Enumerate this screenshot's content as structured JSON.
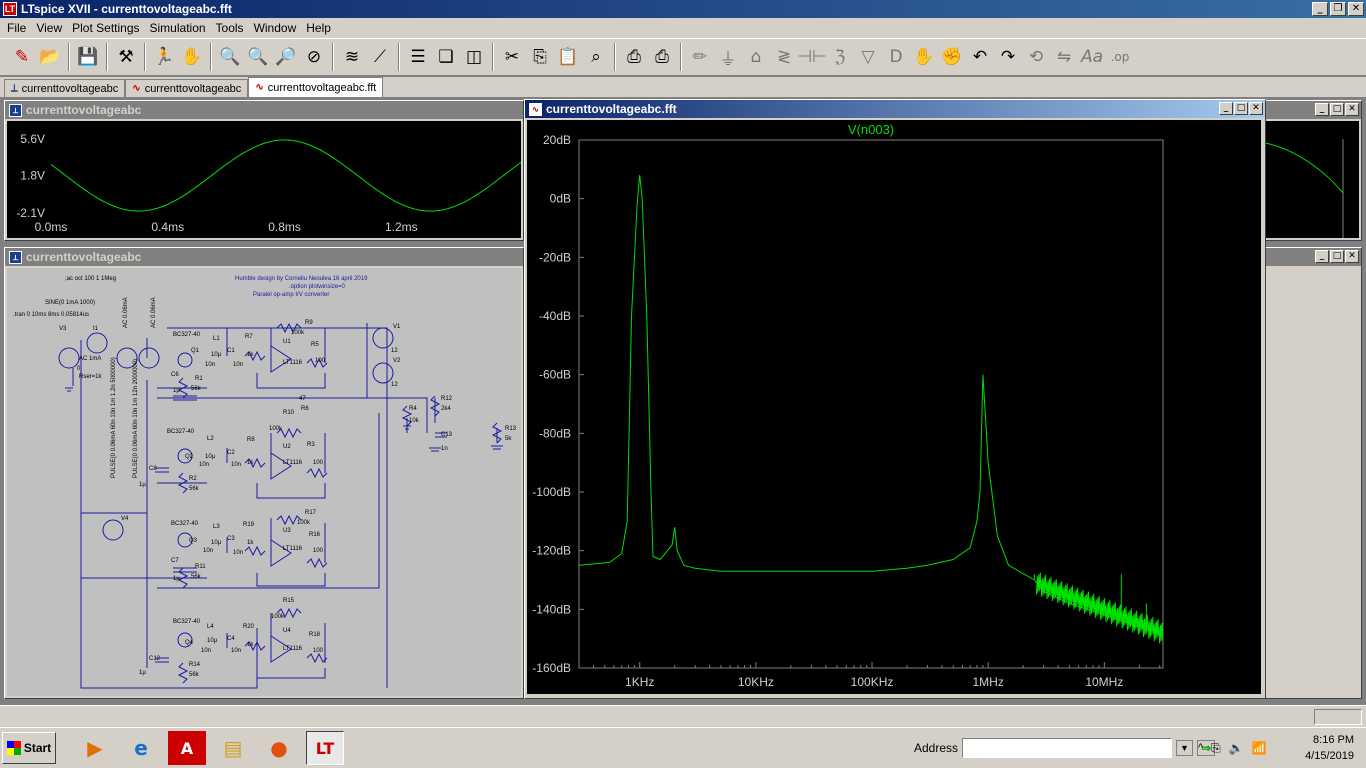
{
  "window": {
    "title": "LTspice XVII - currenttovoltageabc.fft",
    "app_icon": "LT"
  },
  "menu": [
    "File",
    "View",
    "Plot Settings",
    "Simulation",
    "Tools",
    "Window",
    "Help"
  ],
  "toolbar_icons": [
    "new-schematic-icon",
    "open-icon",
    "save-icon",
    "control-panel-icon",
    "run-icon",
    "halt-icon",
    "zoom-in-icon",
    "zoom-out-icon",
    "zoom-fit-icon",
    "zoom-cancel-icon",
    "autorange-icon",
    "pick-visible-traces-icon",
    "tile-horizontal-icon",
    "cascade-icon",
    "tile-vertical-icon",
    "cut-icon",
    "copy-icon",
    "paste-icon",
    "find-icon",
    "print-icon",
    "print-setup-icon",
    "draw-wire-icon",
    "ground-icon",
    "label-net-icon",
    "resistor-icon",
    "capacitor-icon",
    "inductor-icon",
    "diode-icon",
    "component-icon",
    "move-icon",
    "drag-icon",
    "undo-icon",
    "redo-icon",
    "rotate-icon",
    "mirror-icon",
    "text-icon",
    "spice-directive-icon"
  ],
  "tabs": [
    {
      "label": "currenttovoltageabc",
      "icon": "schematic-icon",
      "active": false
    },
    {
      "label": "currenttovoltageabc",
      "icon": "waveform-icon",
      "active": false
    },
    {
      "label": "currenttovoltageabc.fft",
      "icon": "waveform-icon",
      "active": true
    }
  ],
  "windows": {
    "time_plot": {
      "title": "currenttovoltageabc"
    },
    "schematic": {
      "title": "currenttovoltageabc"
    },
    "fft_plot": {
      "title": "currenttovoltageabc.fft"
    }
  },
  "time_chart": {
    "type": "line",
    "title": "",
    "y_ticks": [
      "5.6V",
      "1.8V",
      "-2.1V"
    ],
    "y_tick_values": [
      5.6,
      1.8,
      -2.1
    ],
    "x_ticks": [
      "0.0ms",
      "0.4ms",
      "0.8ms",
      "1.2ms"
    ],
    "x_tick_values": [
      0.0,
      0.4,
      0.8,
      1.2
    ],
    "xlim": [
      0.0,
      1.61
    ],
    "ylim": [
      -2.1,
      5.6
    ],
    "series": [
      {
        "x": [
          0.0,
          0.1,
          0.25,
          0.5,
          0.75,
          1.0,
          1.25,
          1.5
        ],
        "y": [
          1.8,
          0.6,
          -1.9,
          1.8,
          5.5,
          1.8,
          -1.9,
          1.8
        ]
      }
    ],
    "color": "#00e000"
  },
  "fft_chart": {
    "type": "line",
    "trace_label": "V(n003)",
    "x_scale": "log",
    "y_ticks": [
      "20dB",
      "0dB",
      "-20dB",
      "-40dB",
      "-60dB",
      "-80dB",
      "-100dB",
      "-120dB",
      "-140dB",
      "-160dB"
    ],
    "y_tick_values": [
      20,
      0,
      -20,
      -40,
      -60,
      -80,
      -100,
      -120,
      -140,
      -160
    ],
    "x_ticks": [
      "1KHz",
      "10KHz",
      "100KHz",
      "1MHz",
      "10MHz"
    ],
    "x_tick_values": [
      1000,
      10000,
      100000,
      1000000,
      10000000
    ],
    "xlim": [
      300,
      32000000
    ],
    "ylim": [
      -160,
      20
    ],
    "series": [
      {
        "x": [
          300,
          550,
          700,
          780,
          850,
          950,
          1000,
          1050,
          1150,
          1250,
          1300,
          1500,
          1900,
          2000,
          2100,
          2400,
          3000,
          5000,
          20000,
          100000,
          200000,
          300000,
          500000,
          700000,
          800000,
          850000,
          900000,
          1000000,
          1200000,
          1500000,
          2500000,
          3000000,
          5000000,
          10000000,
          20000000,
          32000000
        ],
        "y": [
          -125,
          -124,
          -121,
          -110,
          -40,
          -2,
          8,
          0,
          -40,
          -100,
          -122,
          -123,
          -118,
          -112,
          -120,
          -125,
          -126,
          -127,
          -127,
          -127,
          -126,
          -125,
          -123,
          -119,
          -110,
          -100,
          -60,
          -90,
          -115,
          -125,
          -130,
          -134,
          -138,
          -142,
          -146,
          -148
        ]
      }
    ],
    "spikes": [
      {
        "x": 2500000,
        "y": -128
      },
      {
        "x": 4500000,
        "y": -136
      },
      {
        "x": 14000000,
        "y": -128
      },
      {
        "x": 23000000,
        "y": -138
      }
    ],
    "color": "#00e000",
    "label_color": "#00e000"
  },
  "schematic_text": {
    "header_line1": "Humble design by Corneliu Neoulea 16 april 2019",
    "header_line2": ".option plotwinsize=0",
    "header_line3": "Paralel op-amp I/V converter",
    "directive1": ";ac oct 100 1 1Meg",
    "directive2": "SINE(0 1mA 1000)",
    "directive3": ".tran 0 10ms 8ms 0.05814us",
    "v3": "V3",
    "i1": "I1",
    "ac1ma": "AC 1mA",
    "zero": "0",
    "rser": "Rser=1k",
    "pulse1": "PULSE(0 0.06mA 60n 10n 1m 1.2n 5000000)",
    "pulse2": "PULSE(0 0.06mA 60n 10n 1m 12n 2000000)",
    "ac006": "AC 0.06mA",
    "ac006b": "AC 0.06mA",
    "q1": "BC327-40",
    "q2": "BC327-40",
    "q3": "BC327-40",
    "q4": "BC327-40",
    "qn1": "Q1",
    "qn2": "Q2",
    "qn3": "Q3",
    "qn4": "Q4",
    "l1": "L1",
    "l2": "L2",
    "l3": "L3",
    "l4": "L4",
    "ind": "10µ",
    "c1": "C1",
    "c2": "C2",
    "c3": "C3",
    "c4": "C4",
    "cap10n": "10n",
    "r7": "R7",
    "r8": "R8",
    "r19": "R19",
    "r20": "R20",
    "r9": "R9",
    "r10": "R10",
    "r17": "R17",
    "r15": "R15",
    "r5": "R5",
    "r3": "R3",
    "r16": "R16",
    "r18": "R18",
    "r1": "R1",
    "r2": "R2",
    "r11": "R11",
    "r14": "R14",
    "r6": "R6",
    "r12": "R12",
    "r4": "R4",
    "r13": "R13",
    "u1": "U1",
    "u2": "U2",
    "u3": "U3",
    "u4": "U4",
    "lt1116": "LT1116",
    "k1": "1k",
    "k100": "100k",
    "r100": "100",
    "k56": "56k",
    "k2": "2k4",
    "k10": "10k",
    "k5": "5k",
    "r47": "47",
    "c6": "C6",
    "c7": "C7",
    "c8": "C8",
    "c12": "C12",
    "c13": "C13",
    "u1c": "1µ",
    "n1": "1n",
    "v1": "V1",
    "v2": "V2",
    "v4": "V4",
    "twelve": "12"
  },
  "taskbar": {
    "start": "Start",
    "apps": [
      "media-player-icon",
      "ie-icon",
      "acrobat-icon",
      "explorer-icon",
      "firefox-icon",
      "ltspice-icon"
    ],
    "address_label": "Address",
    "address_value": "",
    "time": "8:16 PM",
    "date": "4/15/2019"
  }
}
